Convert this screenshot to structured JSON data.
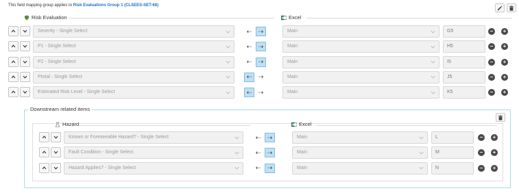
{
  "header": {
    "prefix": "This field mapping group applies to",
    "group_link": "Risk Evaluations Group 1 (CLSEES-SET-68)"
  },
  "toolbar": {
    "edit_icon": "edit-icon",
    "delete_icon": "trash-icon"
  },
  "main": {
    "source_label": "Risk Evaluation",
    "target_label": "Excel",
    "rows": [
      {
        "field": "Severity - Single Select",
        "direction": "right",
        "sheet": "Main",
        "column": "G5"
      },
      {
        "field": "P1 - Single Select",
        "direction": "right",
        "sheet": "Main",
        "column": "H5"
      },
      {
        "field": "P2 - Single Select",
        "direction": "right",
        "sheet": "Main",
        "column": "I5"
      },
      {
        "field": "Ptotal - Single Select",
        "direction": "left",
        "sheet": "Main",
        "column": "J5"
      },
      {
        "field": "Estimated Risk Level - Single Select",
        "direction": "left",
        "sheet": "Main",
        "column": "K5"
      }
    ]
  },
  "downstream": {
    "legend": "Downstream related items",
    "source_label": "Hazard",
    "target_label": "Excel",
    "rows": [
      {
        "field": "Known or Foreseeable Hazard? - Single Select",
        "direction": "right",
        "sheet": "Main",
        "column": "L"
      },
      {
        "field": "Fault Condition - Single Select",
        "direction": "right",
        "sheet": "Main",
        "column": "M"
      },
      {
        "field": "Hazard Applies? - Single Select",
        "direction": "right",
        "sheet": "Main",
        "column": "N"
      }
    ]
  },
  "glyphs": {
    "left_arrow": "⇠",
    "right_arrow": "⇢",
    "minus": "−",
    "plus": "+"
  },
  "colors": {
    "link": "#1f6fc4",
    "arrow_active": "#bfe0f3",
    "downstream_border": "#a8dbe0",
    "excel_green": "#1e7145"
  }
}
